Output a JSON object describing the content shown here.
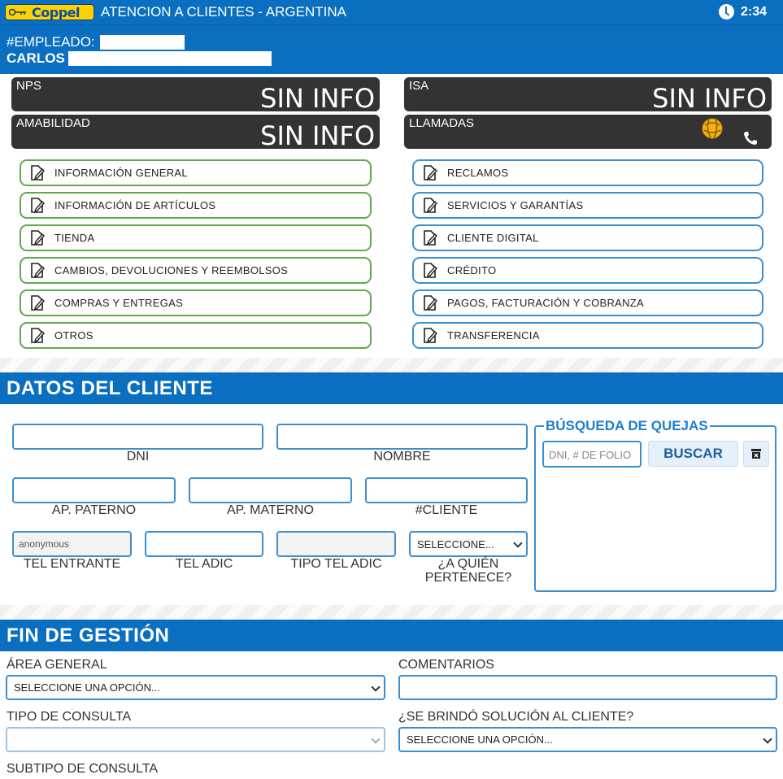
{
  "header": {
    "logo_text": "Coppel",
    "title": "ATENCION A CLIENTES - ARGENTINA",
    "time": "2:34",
    "employee_label": "#EMPLEADO:",
    "employee_name": "CARLOS"
  },
  "metrics": {
    "nps": {
      "label": "NPS",
      "value": "SIN INFO"
    },
    "isa": {
      "label": "ISA",
      "value": "SIN INFO"
    },
    "amabilidad": {
      "label": "AMABILIDAD",
      "value": "SIN INFO"
    },
    "llamadas": {
      "label": "LLAMADAS"
    }
  },
  "categories_left": [
    "INFORMACIÓN GENERAL",
    "INFORMACIÓN DE ARTÍCULOS",
    "TIENDA",
    "CAMBIOS, DEVOLUCIONES Y REEMBOLSOS",
    "COMPRAS Y ENTREGAS",
    "OTROS"
  ],
  "categories_right": [
    "RECLAMOS",
    "SERVICIOS Y GARANTÍAS",
    "CLIENTE DIGITAL",
    "CRÉDITO",
    "PAGOS, FACTURACIÓN Y COBRANZA",
    "TRANSFERENCIA"
  ],
  "datos_cliente": {
    "heading": "DATOS DEL CLIENTE",
    "dni": "DNI",
    "nombre": "NOMBRE",
    "ap_paterno": "AP. PATERNO",
    "ap_materno": "AP. MATERNO",
    "cliente": "#CLIENTE",
    "tel_entrante": "TEL ENTRANTE",
    "tel_entrante_value": "anonymous",
    "tel_adic": "TEL ADIC",
    "tipo_tel_adic": "TIPO TEL ADIC",
    "pertenece_label_1": "¿A QUIÉN",
    "pertenece_label_2": "PERTENECE?",
    "pertenece_select": "SELECCIONE..."
  },
  "quejas": {
    "legend": "BÚSQUEDA DE QUEJAS",
    "placeholder": "DNI, # DE FOLIO",
    "button": "BUSCAR"
  },
  "fin_gestion": {
    "heading": "FIN DE GESTIÓN",
    "area_general": "ÁREA GENERAL",
    "area_select": "SELECCIONE UNA OPCIÓN...",
    "comentarios": "COMENTARIOS",
    "tipo_consulta": "TIPO DE CONSULTA",
    "solucion": "¿SE BRINDÓ SOLUCIÓN AL CLIENTE?",
    "solucion_select": "SELECCIONE UNA OPCIÓN...",
    "subtipo": "SUBTIPO DE CONSULTA"
  }
}
